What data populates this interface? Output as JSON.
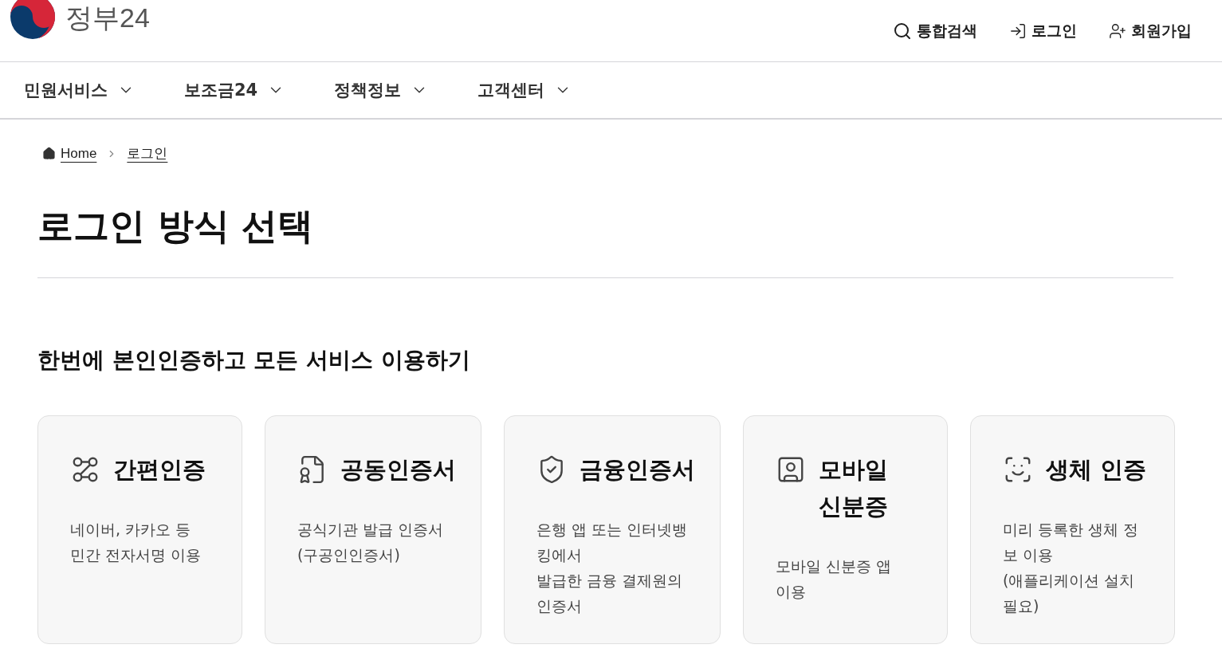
{
  "header": {
    "logo_text": "정부24",
    "actions": [
      {
        "kind": "search",
        "label": "통합검색"
      },
      {
        "kind": "login",
        "label": "로그인"
      },
      {
        "kind": "signup",
        "label": "회원가입"
      }
    ]
  },
  "nav": [
    {
      "label": "민원서비스"
    },
    {
      "label": "보조금24"
    },
    {
      "label": "정책정보"
    },
    {
      "label": "고객센터"
    }
  ],
  "breadcrumb": [
    "Home",
    "로그인"
  ],
  "title": "로그인 방식 선택",
  "section_heading": "한번에 본인인증하고 모든 서비스 이용하기",
  "methods": [
    {
      "kind": "simple",
      "title": "간편인증",
      "description": [
        "네이버, 카카오 등",
        "민간 전자서명 이용"
      ]
    },
    {
      "kind": "joint",
      "title": "공동인증서",
      "description": [
        "공식기관 발급 인증서",
        "(구공인인증서)"
      ]
    },
    {
      "kind": "financial",
      "title": "금융인증서",
      "description": [
        "은행 앱 또는 인터넷뱅",
        "킹에서",
        "발급한 금융 결제원의",
        "인증서"
      ]
    },
    {
      "kind": "mobile",
      "title": "모바일 신분증",
      "description": [
        "모바일 신분증 앱",
        "이용"
      ]
    },
    {
      "kind": "biometric",
      "title": "생체 인증",
      "description": [
        "미리 등록한 생체 정",
        "보 이용",
        "(애플리케이션 설치",
        "필요)"
      ]
    }
  ]
}
